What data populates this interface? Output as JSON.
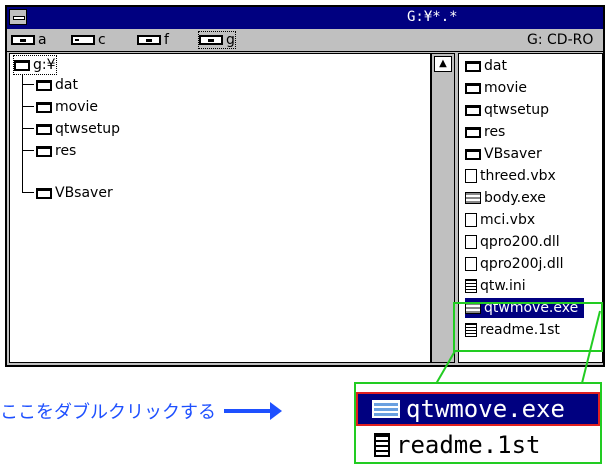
{
  "window": {
    "title": "G:¥*.*"
  },
  "drives": [
    {
      "letter": "a",
      "type": "floppy-drive-icon"
    },
    {
      "letter": "c",
      "type": "hard-disk-icon"
    },
    {
      "letter": "f",
      "type": "cdrom-icon"
    },
    {
      "letter": "g",
      "type": "cdrom-icon",
      "selected": true
    }
  ],
  "drive_label": "G: CD-RO",
  "tree": {
    "root": "g:¥",
    "children": [
      "dat",
      "movie",
      "qtwsetup",
      "res",
      "VBsaver"
    ]
  },
  "files": [
    {
      "name": "dat",
      "icon": "folder-icon"
    },
    {
      "name": "movie",
      "icon": "folder-icon"
    },
    {
      "name": "qtwsetup",
      "icon": "folder-icon"
    },
    {
      "name": "res",
      "icon": "folder-icon"
    },
    {
      "name": "VBsaver",
      "icon": "folder-icon"
    },
    {
      "name": "threed.vbx",
      "icon": "file-icon"
    },
    {
      "name": "body.exe",
      "icon": "exe-icon"
    },
    {
      "name": "mci.vbx",
      "icon": "file-icon"
    },
    {
      "name": "qpro200.dll",
      "icon": "file-icon"
    },
    {
      "name": "qpro200j.dll",
      "icon": "file-icon"
    },
    {
      "name": "qtw.ini",
      "icon": "text-file-icon"
    },
    {
      "name": "qtwmove.exe",
      "icon": "exe-icon",
      "selected": true
    },
    {
      "name": "readme.1st",
      "icon": "text-file-icon"
    }
  ],
  "zoom": {
    "selected": "qtwmove.exe",
    "next": "readme.1st"
  },
  "annotation": "ここをダブルクリックする",
  "colors": {
    "titlebar": "#000080",
    "highlight_box": "#22cc22",
    "zoom_border": "#e02020",
    "annotation": "#1e50ff"
  }
}
